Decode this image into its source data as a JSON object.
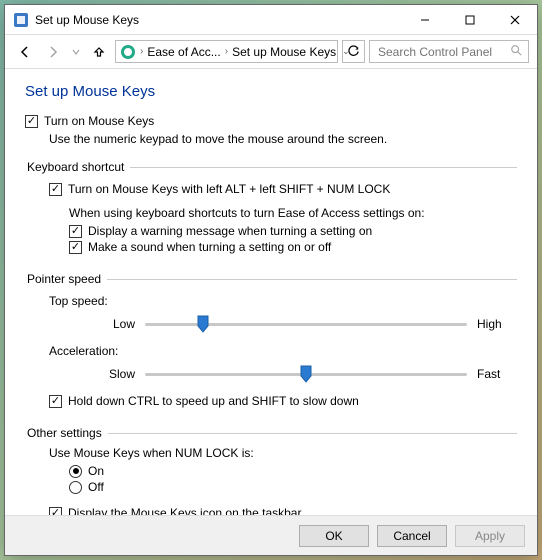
{
  "window": {
    "title": "Set up Mouse Keys"
  },
  "nav": {
    "breadcrumb": [
      "Ease of Acc...",
      "Set up Mouse Keys"
    ],
    "search_placeholder": "Search Control Panel"
  },
  "page": {
    "heading": "Set up Mouse Keys",
    "turn_on_label": "Turn on Mouse Keys",
    "turn_on_checked": true,
    "description": "Use the numeric keypad to move the mouse around the screen."
  },
  "shortcut": {
    "legend": "Keyboard shortcut",
    "enable_label": "Turn on Mouse Keys with left ALT + left SHIFT + NUM LOCK",
    "enable_checked": true,
    "when_using_text": "When using keyboard shortcuts to turn Ease of Access settings on:",
    "warning_label": "Display a warning message when turning a setting on",
    "warning_checked": true,
    "sound_label": "Make a sound when turning a setting on or off",
    "sound_checked": true
  },
  "speed": {
    "legend": "Pointer speed",
    "top_speed_label": "Top speed:",
    "top_speed_left": "Low",
    "top_speed_right": "High",
    "top_speed_value_pct": 18,
    "accel_label": "Acceleration:",
    "accel_left": "Slow",
    "accel_right": "Fast",
    "accel_value_pct": 50,
    "ctrl_shift_label": "Hold down CTRL to speed up and SHIFT to slow down",
    "ctrl_shift_checked": true
  },
  "other": {
    "legend": "Other settings",
    "use_when_label": "Use Mouse Keys when NUM LOCK is:",
    "on_label": "On",
    "off_label": "Off",
    "selected": "on",
    "taskbar_label": "Display the Mouse Keys icon on the taskbar",
    "taskbar_checked": true
  },
  "footer": {
    "ok": "OK",
    "cancel": "Cancel",
    "apply": "Apply"
  }
}
